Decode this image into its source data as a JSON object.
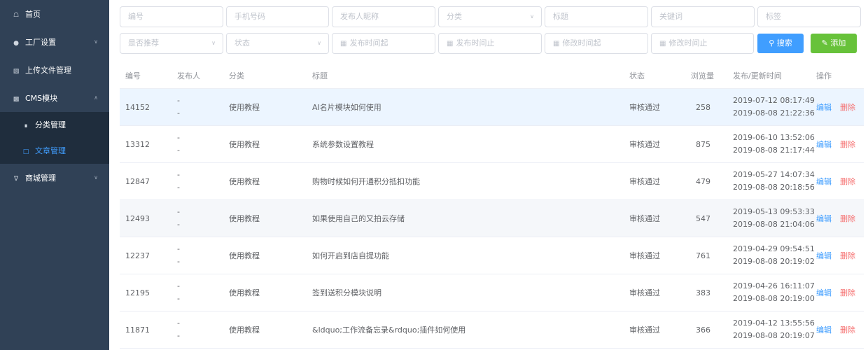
{
  "sidebar": {
    "items": [
      {
        "label": "首页",
        "icon": "home-icon"
      },
      {
        "label": "工厂设置",
        "icon": "gear-icon"
      },
      {
        "label": "上传文件管理",
        "icon": "upload-icon"
      },
      {
        "label": "CMS模块",
        "icon": "cms-icon"
      },
      {
        "label": "商城管理",
        "icon": "cart-icon"
      }
    ],
    "cms_children": [
      {
        "label": "分类管理",
        "icon": "grid-icon"
      },
      {
        "label": "文章管理",
        "icon": "document-icon"
      }
    ]
  },
  "filters": {
    "id": "编号",
    "phone": "手机号码",
    "nickname": "发布人昵称",
    "category": "分类",
    "title": "标题",
    "keyword": "关键词",
    "tag": "标签",
    "recommend": "是否推荐",
    "status": "状态",
    "publish_from": "发布时间起",
    "publish_to": "发布时间止",
    "modify_from": "修改时间起",
    "modify_to": "修改时间止",
    "search_label": "搜索",
    "add_label": "添加"
  },
  "table": {
    "headers": {
      "id": "编号",
      "publisher": "发布人",
      "category": "分类",
      "title": "标题",
      "status": "状态",
      "views": "浏览量",
      "time": "发布/更新时间",
      "action": "操作"
    },
    "edit_label": "编辑",
    "delete_label": "删除",
    "rows": [
      {
        "id": "14152",
        "pub1": "-",
        "pub2": "-",
        "category": "使用教程",
        "title": "AI名片模块如何使用",
        "status": "审核通过",
        "views": "258",
        "published": "2019-07-12 08:17:49",
        "updated": "2019-08-08 21:22:36"
      },
      {
        "id": "13312",
        "pub1": "-",
        "pub2": "-",
        "category": "使用教程",
        "title": "系统参数设置教程",
        "status": "审核通过",
        "views": "875",
        "published": "2019-06-10 13:52:06",
        "updated": "2019-08-08 21:17:44"
      },
      {
        "id": "12847",
        "pub1": "-",
        "pub2": "-",
        "category": "使用教程",
        "title": "购物时候如何开通积分抵扣功能",
        "status": "审核通过",
        "views": "479",
        "published": "2019-05-27 14:07:34",
        "updated": "2019-08-08 20:18:56"
      },
      {
        "id": "12493",
        "pub1": "-",
        "pub2": "-",
        "category": "使用教程",
        "title": "如果使用自己的又拍云存储",
        "status": "审核通过",
        "views": "547",
        "published": "2019-05-13 09:53:33",
        "updated": "2019-08-08 21:04:06"
      },
      {
        "id": "12237",
        "pub1": "-",
        "pub2": "-",
        "category": "使用教程",
        "title": "如何开启到店自提功能",
        "status": "审核通过",
        "views": "761",
        "published": "2019-04-29 09:54:51",
        "updated": "2019-08-08 20:19:02"
      },
      {
        "id": "12195",
        "pub1": "-",
        "pub2": "-",
        "category": "使用教程",
        "title": "签到送积分模块说明",
        "status": "审核通过",
        "views": "383",
        "published": "2019-04-26 16:11:07",
        "updated": "2019-08-08 20:19:00"
      },
      {
        "id": "11871",
        "pub1": "-",
        "pub2": "-",
        "category": "使用教程",
        "title": "&ldquo;工作流备忘录&rdquo;插件如何使用",
        "status": "审核通过",
        "views": "366",
        "published": "2019-04-12 13:55:56",
        "updated": "2019-08-08 20:19:07"
      }
    ]
  }
}
